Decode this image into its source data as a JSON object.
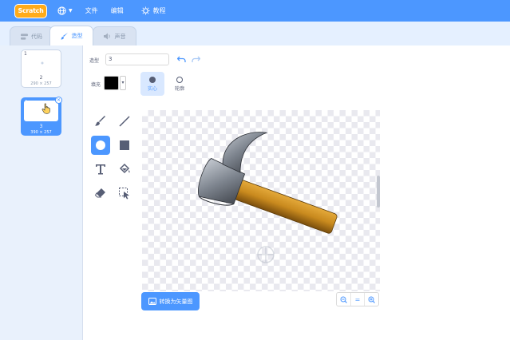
{
  "menubar": {
    "logo": "Scratch",
    "file": "文件",
    "edit": "编辑",
    "tutorials": "教程"
  },
  "tabs": [
    {
      "label": "代码"
    },
    {
      "label": "造型"
    },
    {
      "label": "声音"
    }
  ],
  "costumes": [
    {
      "num": "1",
      "name": "2",
      "size": "290 × 257"
    },
    {
      "num": "2",
      "name": "3",
      "size": "390 × 257"
    }
  ],
  "editor": {
    "costume_label": "造型",
    "costume_name": "3",
    "fill_label": "填充",
    "fill_color": "#000000",
    "mode_filled": "实心",
    "mode_outline": "轮廓",
    "convert_label": "转换为矢量图",
    "zoom_reset": "="
  },
  "colors": {
    "accent": "#4c97ff",
    "logo": "#ffab19"
  }
}
